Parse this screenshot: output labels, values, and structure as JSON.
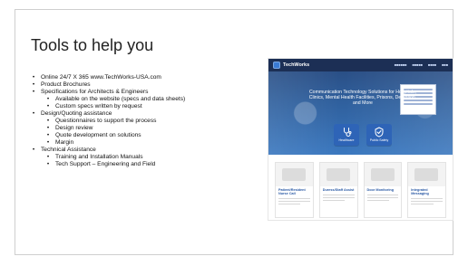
{
  "slide": {
    "title": "Tools to help you",
    "bullets": [
      {
        "level": 1,
        "text": "Online 24/7 X 365 www.TechWorks-USA.com"
      },
      {
        "level": 1,
        "text": "Product Brochures"
      },
      {
        "level": 1,
        "text": "Specifications for Architects & Engineers"
      },
      {
        "level": 2,
        "text": "Available on the website (specs and data sheets)"
      },
      {
        "level": 2,
        "text": "Custom specs written by request"
      },
      {
        "level": 1,
        "text": "Design/Quoting assistance"
      },
      {
        "level": 2,
        "text": "Questionnaires to support the process"
      },
      {
        "level": 2,
        "text": "Design review"
      },
      {
        "level": 2,
        "text": "Quote development on solutions"
      },
      {
        "level": 2,
        "text": "Margin"
      },
      {
        "level": 1,
        "text": "Technical Assistance"
      },
      {
        "level": 2,
        "text": "Training and Installation Manuals"
      },
      {
        "level": 2,
        "text": "Tech Support – Engineering and Field"
      }
    ]
  },
  "website_screenshot": {
    "brand": "TechWorks",
    "hero_text": "Communication Technology Solutions for Hospitals, Clinics, Mental Health Facilities, Prisons, Detention, and More",
    "tiles": [
      {
        "label": "Healthcare"
      },
      {
        "label": "Public Safety"
      }
    ],
    "cards": [
      {
        "title": "Patient/Resident Nurse Call"
      },
      {
        "title": "Duress/Staff Assist"
      },
      {
        "title": "Door Monitoring"
      },
      {
        "title": "Integrated Messaging"
      }
    ]
  }
}
